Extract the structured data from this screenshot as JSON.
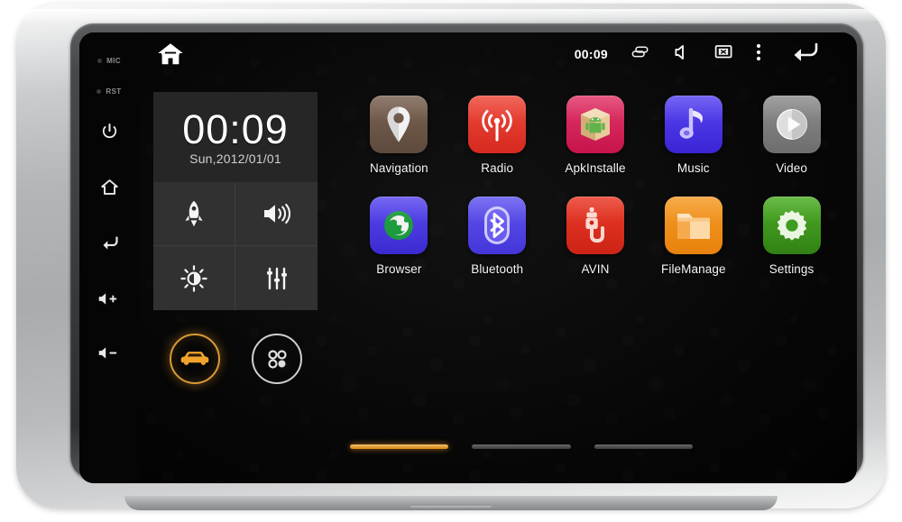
{
  "device": {
    "name": "car-head-unit",
    "hardkeys": [
      {
        "name": "mic-indicator",
        "label": "MIC",
        "icon": "led-dot"
      },
      {
        "name": "reset-indicator",
        "label": "RST",
        "icon": "led-dot"
      },
      {
        "name": "power-key",
        "label": "",
        "icon": "power-icon"
      },
      {
        "name": "home-key",
        "label": "",
        "icon": "home-icon"
      },
      {
        "name": "back-key",
        "label": "",
        "icon": "back-arrow-icon"
      },
      {
        "name": "volume-up-key",
        "label": "",
        "icon": "volume-up-icon"
      },
      {
        "name": "volume-down-key",
        "label": "",
        "icon": "volume-down-icon"
      }
    ]
  },
  "statusbar": {
    "home_icon": "home-icon",
    "time": "00:09",
    "icons": [
      {
        "name": "recents-icon",
        "glyph": "recents"
      },
      {
        "name": "volume-mute-icon",
        "glyph": "speaker-mute"
      },
      {
        "name": "screen-off-icon",
        "glyph": "box-x"
      },
      {
        "name": "overflow-menu-icon",
        "glyph": "three-dots"
      },
      {
        "name": "back-icon",
        "glyph": "back-arrow"
      }
    ]
  },
  "widgets": {
    "clock": {
      "time": "00:09",
      "date": "Sun,2012/01/01"
    },
    "toggles": [
      {
        "name": "boost-toggle",
        "icon": "rocket-icon"
      },
      {
        "name": "volume-toggle",
        "icon": "speaker-waves-icon"
      },
      {
        "name": "brightness-toggle",
        "icon": "brightness-icon"
      },
      {
        "name": "equalizer-toggle",
        "icon": "sliders-icon"
      }
    ],
    "shortcuts": [
      {
        "name": "car-mode-button",
        "icon": "car-icon",
        "color": "#e8972a",
        "active": true
      },
      {
        "name": "app-drawer-button",
        "icon": "apps-icon",
        "color": "#d8d8d8",
        "active": false
      }
    ]
  },
  "apps": [
    {
      "name": "app-navigation",
      "label": "Navigation",
      "icon": "map-pin-icon",
      "bg": "#6b5546"
    },
    {
      "name": "app-radio",
      "label": "Radio",
      "icon": "radio-waves-icon",
      "bg": "#e53b30"
    },
    {
      "name": "app-apkinstaller",
      "label": "ApkInstalle",
      "icon": "package-android-icon",
      "bg": "#d81f57"
    },
    {
      "name": "app-music",
      "label": "Music",
      "icon": "music-note-icon",
      "bg": "#4733e8"
    },
    {
      "name": "app-video",
      "label": "Video",
      "icon": "play-circle-icon",
      "bg": "#7d7d7d"
    },
    {
      "name": "app-browser",
      "label": "Browser",
      "icon": "globe-icon",
      "bg": "#4a3ee0"
    },
    {
      "name": "app-bluetooth",
      "label": "Bluetooth",
      "icon": "bluetooth-icon",
      "bg": "#5246e6"
    },
    {
      "name": "app-avin",
      "label": "AVIN",
      "icon": "rca-plug-icon",
      "bg": "#e0301f"
    },
    {
      "name": "app-filemanager",
      "label": "FileManage",
      "icon": "folder-icon",
      "bg": "#ef8c16"
    },
    {
      "name": "app-settings",
      "label": "Settings",
      "icon": "gear-icon",
      "bg": "#3f9c1f"
    }
  ],
  "pager": {
    "count": 3,
    "active_index": 0,
    "active_color": "#d6830f"
  }
}
